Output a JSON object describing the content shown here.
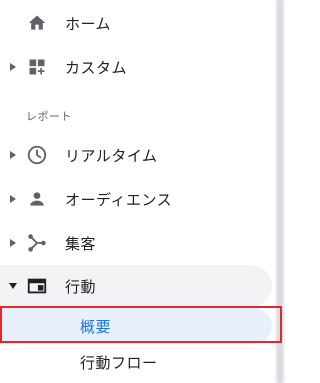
{
  "nav": {
    "home": "ホーム",
    "custom": "カスタム",
    "section_reports": "レポート",
    "realtime": "リアルタイム",
    "audience": "オーディエンス",
    "acquisition": "集客",
    "behavior": "行動",
    "sub_items": [
      "概要",
      "行動フロー"
    ]
  },
  "colors": {
    "active_text": "#1a73e8",
    "highlight_border": "#e3262f",
    "icon": "#5f6368"
  }
}
